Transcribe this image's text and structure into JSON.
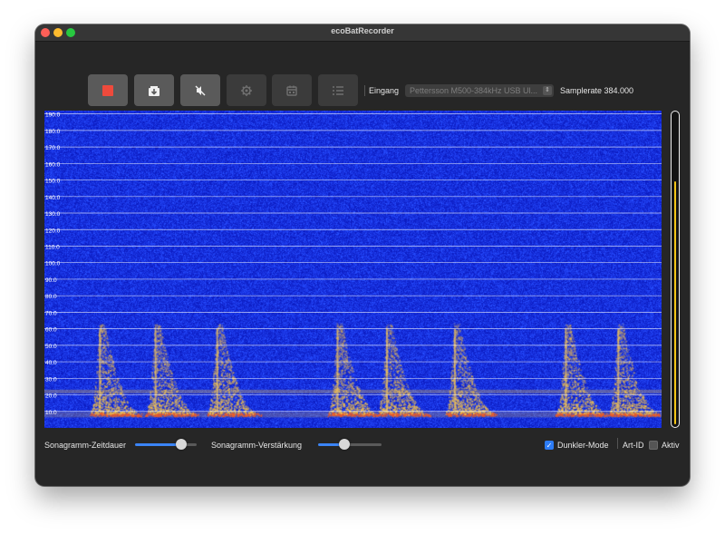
{
  "window": {
    "title": "ecoBatRecorder"
  },
  "toolbar": {
    "buttons": [
      {
        "icon": "stop-icon",
        "enabled": true
      },
      {
        "icon": "save-download-icon",
        "enabled": true
      },
      {
        "icon": "mute-icon",
        "enabled": true
      },
      {
        "icon": "gear-icon",
        "enabled": false
      },
      {
        "icon": "calendar-icon",
        "enabled": false
      },
      {
        "icon": "list-icon",
        "enabled": false
      }
    ],
    "input_label": "Eingang",
    "input_device": "Pettersson M500-384kHz USB Ul...",
    "samplerate_label": "Samplerate 384.000"
  },
  "spectrogram": {
    "y_tick_labels": [
      "190.0",
      "180.0",
      "170.0",
      "160.0",
      "150.0",
      "140.0",
      "130.0",
      "120.0",
      "110.0",
      "100.0",
      "90.0",
      "80.0",
      "70.0",
      "60.0",
      "50.0",
      "40.0",
      "30.0",
      "20.0",
      "10.0"
    ],
    "y_max": 192,
    "background_color": "#1a2ad8",
    "call_color": "#f5c34a",
    "calls_x_fraction": [
      0.09,
      0.18,
      0.28,
      0.475,
      0.555,
      0.665,
      0.845,
      0.93
    ]
  },
  "level_meter": {
    "level_fraction": 0.78,
    "color": "#f5c518"
  },
  "controls": {
    "duration_label": "Sonagramm-Zeitdauer",
    "duration_value": 0.8,
    "gain_label": "Sonagramm-Verstärkung",
    "gain_value": 0.4,
    "dark_mode_label": "Dunkler-Mode",
    "dark_mode_checked": true,
    "art_id_label": "Art-ID",
    "aktiv_label": "Aktiv",
    "aktiv_checked": false
  }
}
